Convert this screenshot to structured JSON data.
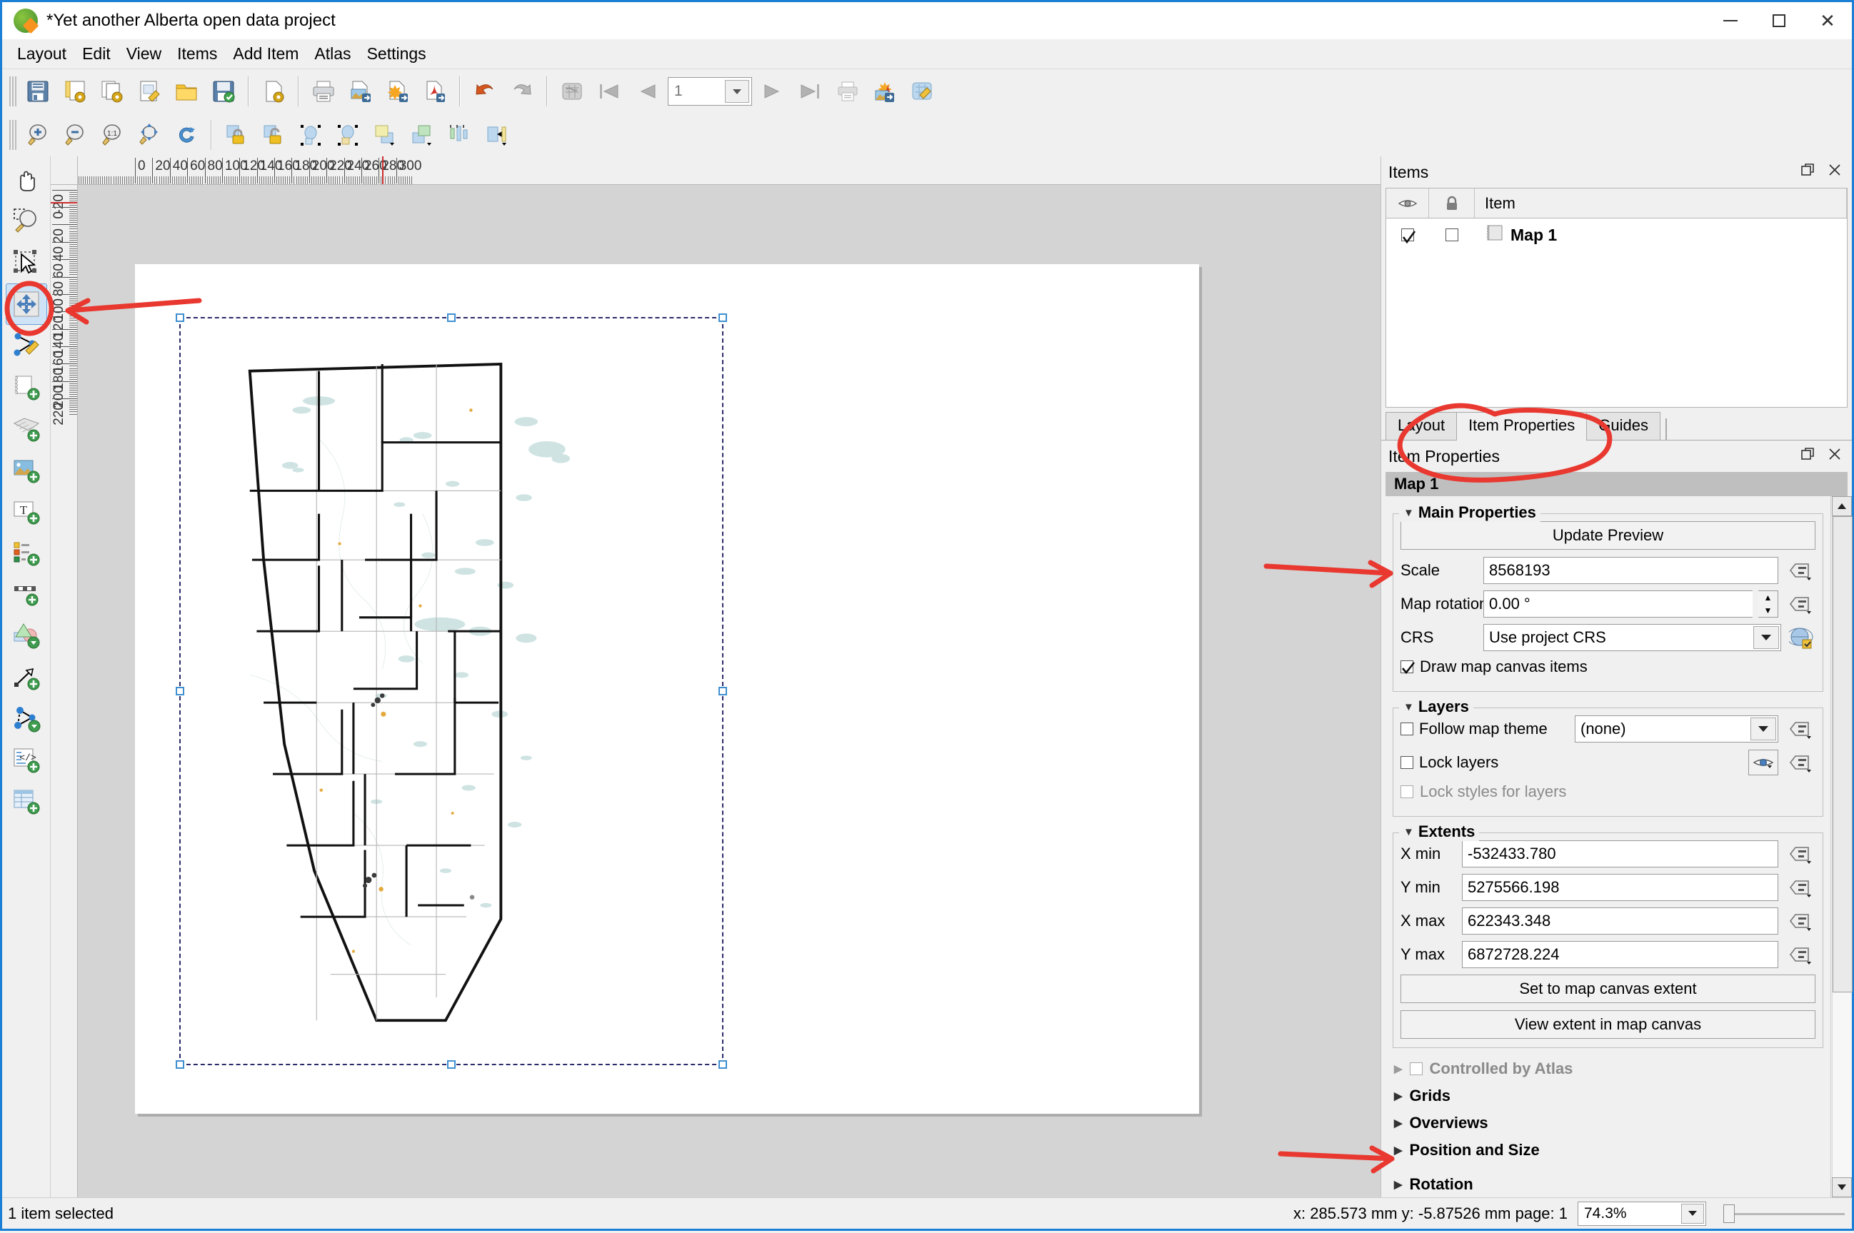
{
  "window": {
    "title": "*Yet another Alberta open data project",
    "logo_icon": "qgis-logo-icon",
    "minimize_label": "—",
    "maximize_label": "□",
    "close_label": "✕"
  },
  "menubar": {
    "items": [
      "Layout",
      "Edit",
      "View",
      "Items",
      "Add Item",
      "Atlas",
      "Settings"
    ]
  },
  "toolbars": {
    "row1": [
      {
        "name": "save-layout-button",
        "icon": "floppy-disk-icon"
      },
      {
        "name": "new-layout-button",
        "icon": "new-layout-icon"
      },
      {
        "name": "duplicate-layout-button",
        "icon": "duplicate-layout-icon"
      },
      {
        "name": "layout-manager-button",
        "icon": "layout-manager-icon"
      },
      {
        "name": "open-template-button",
        "icon": "folder-icon"
      },
      {
        "name": "save-template-button",
        "icon": "save-template-icon"
      },
      {
        "name": "new-from-template-button",
        "icon": "new-page-icon"
      },
      {
        "name": "print-button",
        "icon": "printer-icon"
      },
      {
        "name": "export-image-button",
        "icon": "export-image-icon"
      },
      {
        "name": "export-svg-button",
        "icon": "export-svg-icon"
      },
      {
        "name": "export-pdf-button",
        "icon": "export-pdf-icon"
      },
      {
        "name": "undo-button",
        "icon": "undo-arrow-icon"
      },
      {
        "name": "redo-button",
        "icon": "redo-arrow-icon"
      }
    ],
    "row2": [
      {
        "name": "zoom-in-button",
        "icon": "zoom-in-icon"
      },
      {
        "name": "zoom-out-button",
        "icon": "zoom-out-icon"
      },
      {
        "name": "zoom-full-button",
        "icon": "zoom-1-1-icon"
      },
      {
        "name": "zoom-to-fit-button",
        "icon": "zoom-extent-icon"
      },
      {
        "name": "refresh-button",
        "icon": "refresh-icon"
      },
      {
        "name": "lock-items-button",
        "icon": "lock-icon"
      },
      {
        "name": "unlock-items-button",
        "icon": "unlock-icon"
      },
      {
        "name": "group-items-button",
        "icon": "group-icon"
      },
      {
        "name": "ungroup-items-button",
        "icon": "ungroup-icon"
      },
      {
        "name": "raise-items-button",
        "icon": "raise-items-icon"
      },
      {
        "name": "lower-items-button",
        "icon": "lower-items-icon"
      },
      {
        "name": "align-left-button",
        "icon": "align-left-icon"
      },
      {
        "name": "align-center-button",
        "icon": "align-center-icon"
      }
    ],
    "atlas": {
      "preview_icon": "atlas-preview-icon",
      "first_icon": "atlas-first-icon",
      "prev_icon": "atlas-prev-icon",
      "page_value": "1",
      "next_icon": "atlas-next-icon",
      "last_icon": "atlas-last-icon",
      "print_icon": "atlas-print-icon",
      "export_icon": "atlas-export-image-icon",
      "settings_icon": "atlas-settings-icon"
    }
  },
  "toolbox": {
    "items": [
      {
        "name": "pan-layout-tool",
        "icon": "pan-hand-icon",
        "selected": false
      },
      {
        "name": "zoom-tool",
        "icon": "zoom-magnifier-icon",
        "selected": false
      },
      {
        "name": "select-move-item-tool",
        "icon": "select-arrow-icon",
        "selected": false
      },
      {
        "name": "move-item-content-tool",
        "icon": "move-item-content-icon",
        "selected": true
      },
      {
        "name": "edit-nodes-tool",
        "icon": "edit-nodes-icon",
        "selected": false
      },
      {
        "name": "add-map-tool",
        "icon": "add-map-icon",
        "selected": false
      },
      {
        "name": "add-3d-map-tool",
        "icon": "add-3d-map-icon",
        "selected": false
      },
      {
        "name": "add-picture-tool",
        "icon": "add-picture-icon",
        "selected": false
      },
      {
        "name": "add-label-tool",
        "icon": "add-label-icon",
        "selected": false
      },
      {
        "name": "add-legend-tool",
        "icon": "add-legend-icon",
        "selected": false
      },
      {
        "name": "add-scalebar-tool",
        "icon": "add-scalebar-icon",
        "selected": false
      },
      {
        "name": "add-shape-tool",
        "icon": "add-shape-icon",
        "selected": false
      },
      {
        "name": "add-arrow-tool",
        "icon": "add-arrow-icon",
        "selected": false
      },
      {
        "name": "add-node-item-tool",
        "icon": "add-node-item-icon",
        "selected": false
      },
      {
        "name": "add-html-tool",
        "icon": "add-html-icon",
        "selected": false
      },
      {
        "name": "add-table-tool",
        "icon": "add-attribute-table-icon",
        "selected": false
      }
    ]
  },
  "rulers": {
    "horizontal_labels": [
      "0",
      "20",
      "40",
      "60",
      "80",
      "100",
      "120",
      "140",
      "160",
      "180",
      "200",
      "220",
      "240",
      "260",
      "280",
      "300"
    ],
    "vertical_labels": [
      "-20",
      "0",
      "20",
      "40",
      "60",
      "80",
      "100",
      "120",
      "140",
      "160",
      "180",
      "200",
      "220"
    ],
    "units": "mm"
  },
  "items_panel": {
    "title": "Items",
    "float_icon": "undock-icon",
    "close_icon": "close-icon",
    "columns": {
      "visibility": "eye-icon",
      "lock": "lock-icon",
      "name": "Item"
    },
    "rows": [
      {
        "name": "Map 1",
        "icon": "map-item-icon",
        "visible": true,
        "locked": false
      }
    ]
  },
  "tabs": {
    "items": [
      {
        "label": "Layout",
        "name": "tab-layout",
        "active": false
      },
      {
        "label": "Item Properties",
        "name": "tab-item-properties",
        "active": true
      },
      {
        "label": "Guides",
        "name": "tab-guides",
        "active": false
      }
    ]
  },
  "item_properties": {
    "title": "Item Properties",
    "float_icon": "undock-icon",
    "close_icon": "close-icon",
    "selected_item": "Map 1",
    "main_properties": {
      "title": "Main Properties",
      "update_preview_label": "Update Preview",
      "scale_label": "Scale",
      "scale_value": "8568193",
      "map_rotation_label": "Map rotation",
      "map_rotation_value": "0.00 °",
      "crs_label": "CRS",
      "crs_value": "Use project CRS",
      "draw_canvas_items_label": "Draw map canvas items",
      "draw_canvas_items_checked": true
    },
    "layers": {
      "title": "Layers",
      "follow_map_theme_label": "Follow map theme",
      "follow_map_theme_checked": false,
      "map_theme_value": "(none)",
      "lock_layers_label": "Lock layers",
      "lock_layers_checked": false,
      "lock_styles_label": "Lock styles for layers",
      "lock_styles_checked": false,
      "lock_styles_disabled": true
    },
    "extents": {
      "title": "Extents",
      "x_min_label": "X min",
      "x_min_value": "-532433.780",
      "y_min_label": "Y min",
      "y_min_value": "5275566.198",
      "x_max_label": "X max",
      "x_max_value": "622343.348",
      "y_max_label": "Y max",
      "y_max_value": "6872728.224",
      "set_canvas_extent_label": "Set to map canvas extent",
      "view_extent_label": "View extent in map canvas"
    },
    "collapsed_sections": [
      {
        "label": "Controlled by Atlas",
        "name": "section-controlled-by-atlas",
        "disabled": true,
        "has_checkbox": true
      },
      {
        "label": "Grids",
        "name": "section-grids",
        "disabled": false,
        "has_checkbox": false
      },
      {
        "label": "Overviews",
        "name": "section-overviews",
        "disabled": false,
        "has_checkbox": false
      },
      {
        "label": "Position and Size",
        "name": "section-position-and-size",
        "disabled": false,
        "has_checkbox": false
      },
      {
        "label": "Rotation",
        "name": "section-rotation",
        "disabled": false,
        "has_checkbox": false
      }
    ]
  },
  "statusbar": {
    "selection_text": "1 item selected",
    "coordinates": "x: 285.573 mm y: -5.87526 mm page: 1",
    "zoom_value": "74.3%"
  },
  "annotations": {
    "color": "#e8382f",
    "marks": [
      {
        "name": "annotation-circle-move-content-tool",
        "shape": "ellipse"
      },
      {
        "name": "annotation-arrow-to-move-content-tool",
        "shape": "arrow"
      },
      {
        "name": "annotation-circle-item-properties-tab",
        "shape": "ellipse"
      },
      {
        "name": "annotation-arrow-to-scale-field",
        "shape": "arrow"
      },
      {
        "name": "annotation-arrow-to-position-and-size",
        "shape": "arrow"
      }
    ]
  }
}
